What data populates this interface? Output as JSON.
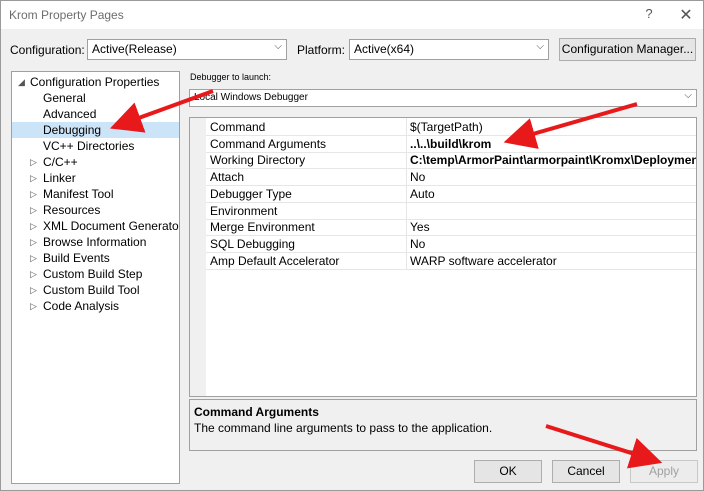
{
  "window": {
    "title": "Krom Property Pages",
    "help_glyph": "?",
    "close_glyph": "✕"
  },
  "config": {
    "configuration_label": "Configuration:",
    "configuration_value": "Active(Release)",
    "platform_label": "Platform:",
    "platform_value": "Active(x64)",
    "manager_button": "Configuration Manager..."
  },
  "tree": {
    "root": "Configuration Properties",
    "items": [
      {
        "label": "General",
        "expandable": false
      },
      {
        "label": "Advanced",
        "expandable": false
      },
      {
        "label": "Debugging",
        "expandable": false,
        "selected": true
      },
      {
        "label": "VC++ Directories",
        "expandable": false
      },
      {
        "label": "C/C++",
        "expandable": true
      },
      {
        "label": "Linker",
        "expandable": true
      },
      {
        "label": "Manifest Tool",
        "expandable": true
      },
      {
        "label": "Resources",
        "expandable": true
      },
      {
        "label": "XML Document Generator",
        "expandable": true
      },
      {
        "label": "Browse Information",
        "expandable": true
      },
      {
        "label": "Build Events",
        "expandable": true
      },
      {
        "label": "Custom Build Step",
        "expandable": true
      },
      {
        "label": "Custom Build Tool",
        "expandable": true
      },
      {
        "label": "Code Analysis",
        "expandable": true
      }
    ]
  },
  "debugger": {
    "label": "Debugger to launch:",
    "value": "Local Windows Debugger"
  },
  "properties": [
    {
      "name": "Command",
      "value": "$(TargetPath)",
      "bold": false
    },
    {
      "name": "Command Arguments",
      "value": "..\\..\\build\\krom",
      "bold": true
    },
    {
      "name": "Working Directory",
      "value": "C:\\temp\\ArmorPaint\\armorpaint\\Kromx\\Deployment",
      "bold": true
    },
    {
      "name": "Attach",
      "value": "No",
      "bold": false
    },
    {
      "name": "Debugger Type",
      "value": "Auto",
      "bold": false
    },
    {
      "name": "Environment",
      "value": "",
      "bold": false
    },
    {
      "name": "Merge Environment",
      "value": "Yes",
      "bold": false
    },
    {
      "name": "SQL Debugging",
      "value": "No",
      "bold": false
    },
    {
      "name": "Amp Default Accelerator",
      "value": "WARP software accelerator",
      "bold": false
    }
  ],
  "description": {
    "title": "Command Arguments",
    "text": "The command line arguments to pass to the application."
  },
  "buttons": {
    "ok": "OK",
    "cancel": "Cancel",
    "apply": "Apply"
  },
  "colors": {
    "selection": "#cce4f7",
    "annotation_arrow": "#e8191b",
    "disabled_text": "#a0a0a0"
  }
}
